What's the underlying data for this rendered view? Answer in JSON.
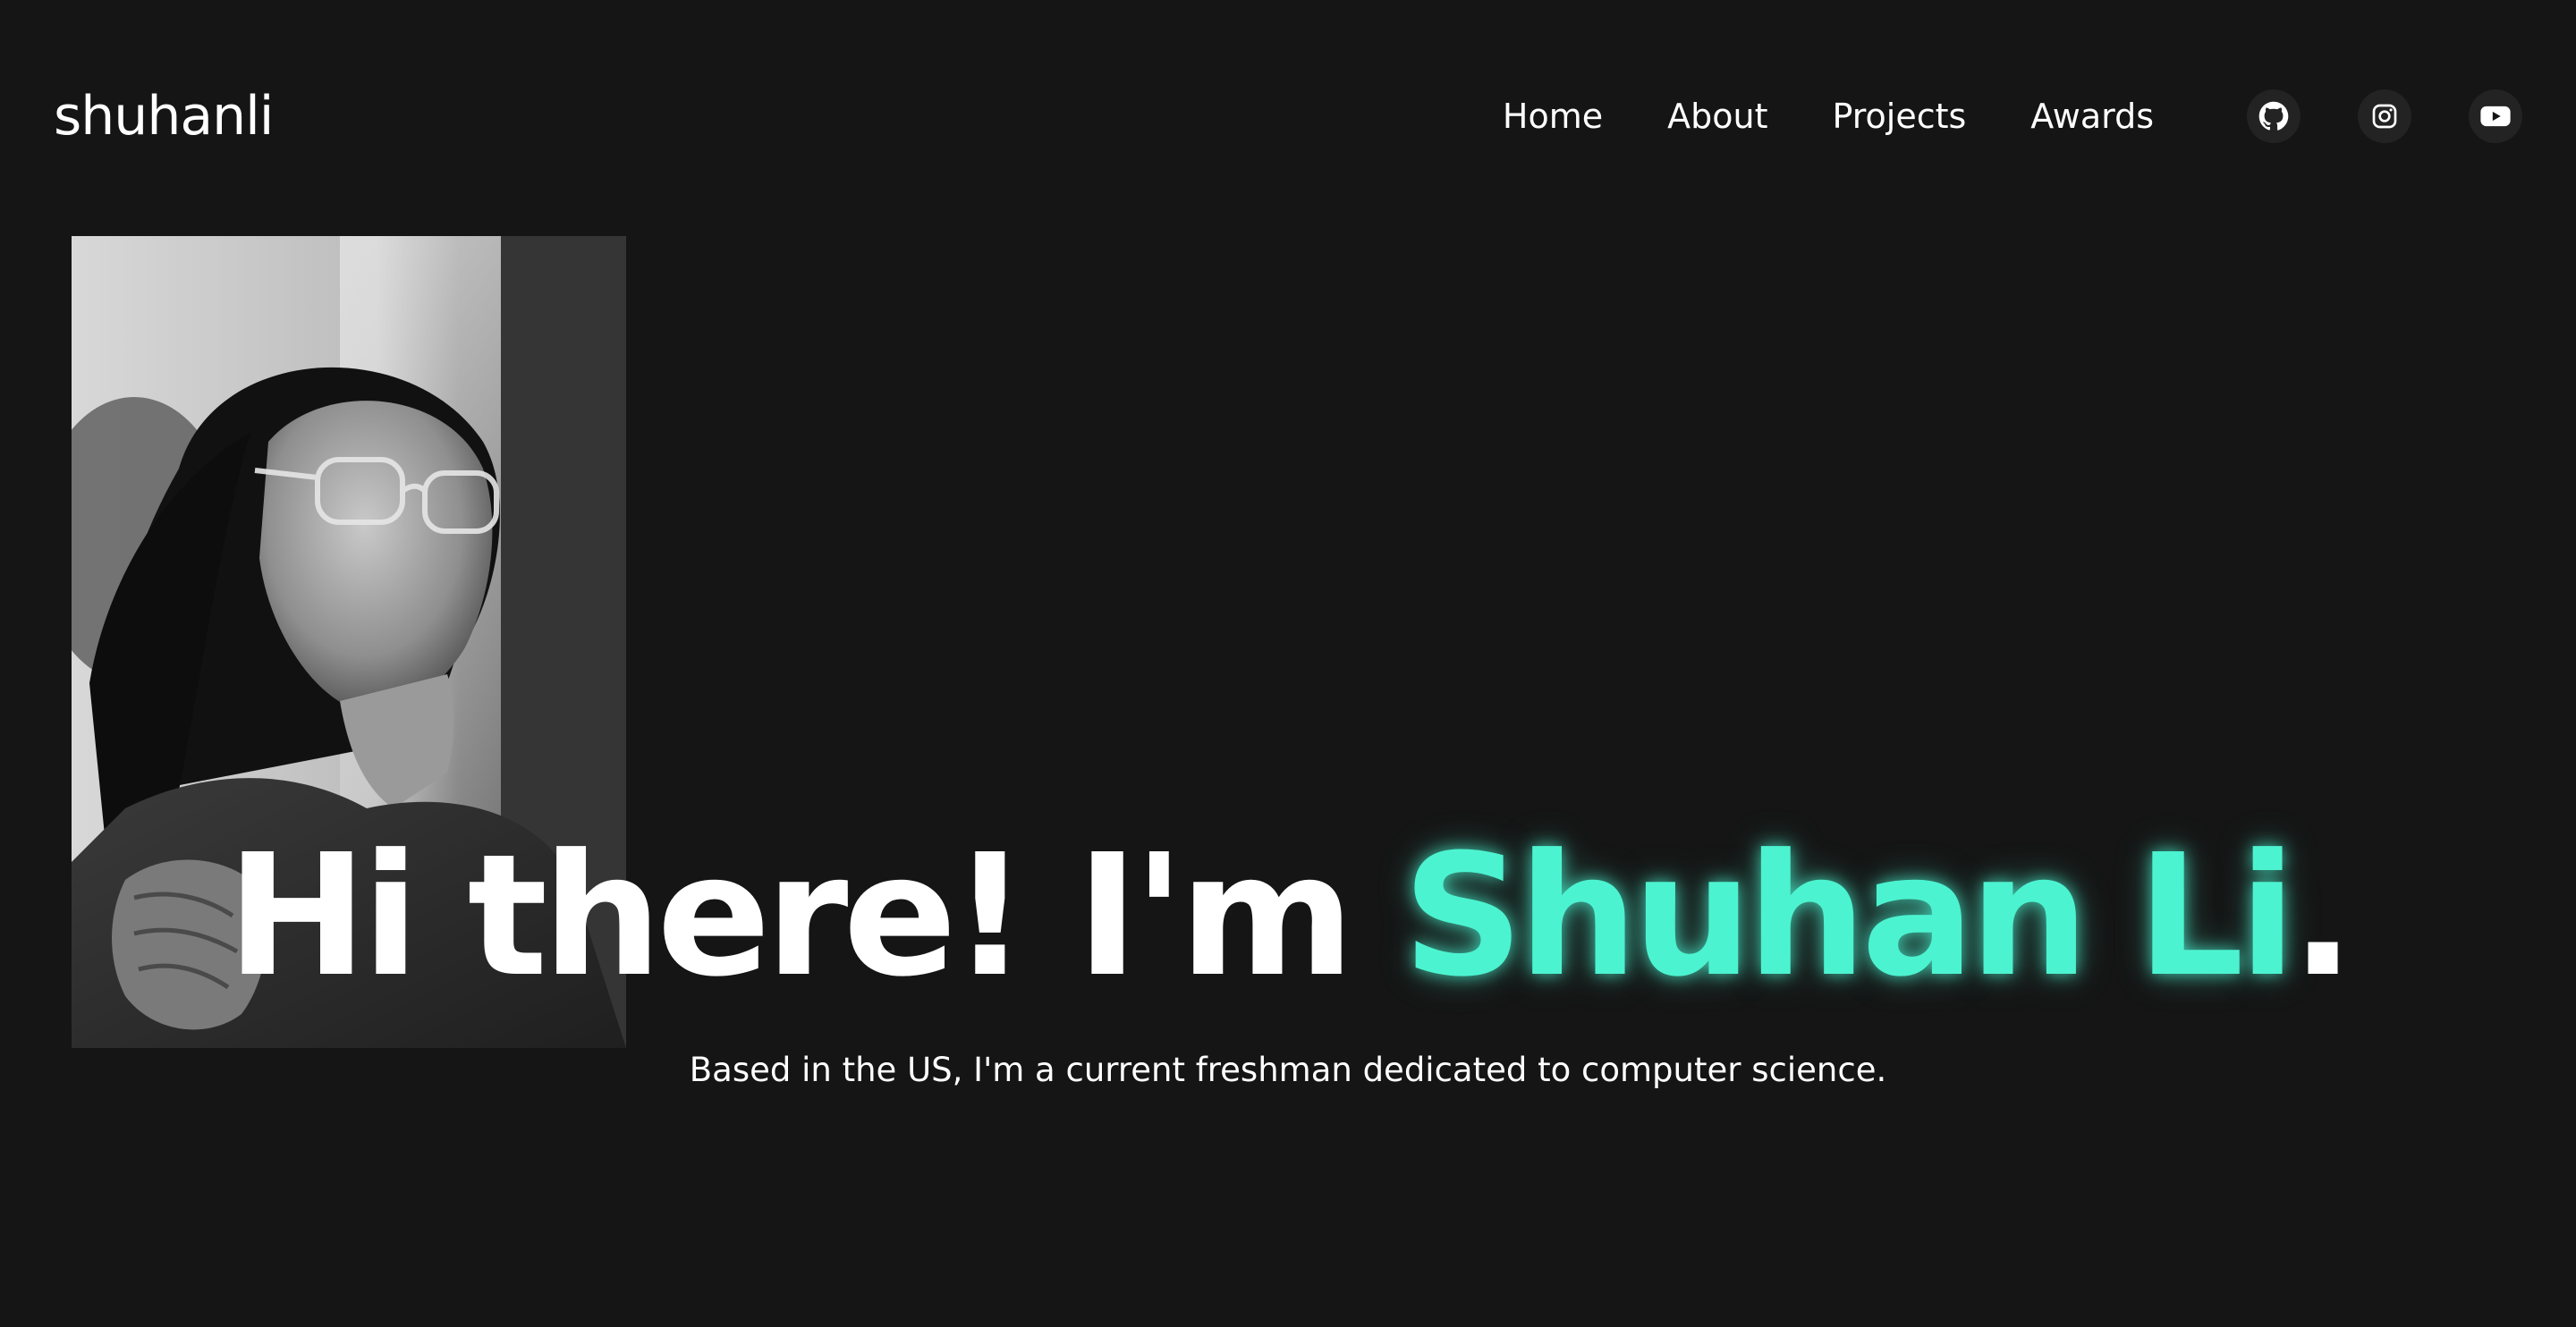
{
  "brand": "shuhanli",
  "nav": {
    "items": [
      {
        "label": "Home"
      },
      {
        "label": "About"
      },
      {
        "label": "Projects"
      },
      {
        "label": "Awards"
      }
    ]
  },
  "socials": [
    {
      "icon": "github-icon"
    },
    {
      "icon": "instagram-icon"
    },
    {
      "icon": "youtube-icon"
    }
  ],
  "hero": {
    "greeting": "Hi there! I'm ",
    "name": "Shuhan Li",
    "punctuation": ".",
    "subtitle": "Based in the US, I'm a current freshman dedicated to computer science."
  },
  "colors": {
    "background": "#151515",
    "accent": "#4cf3d0",
    "text": "#ffffff",
    "icon_button_bg": "#232323"
  }
}
